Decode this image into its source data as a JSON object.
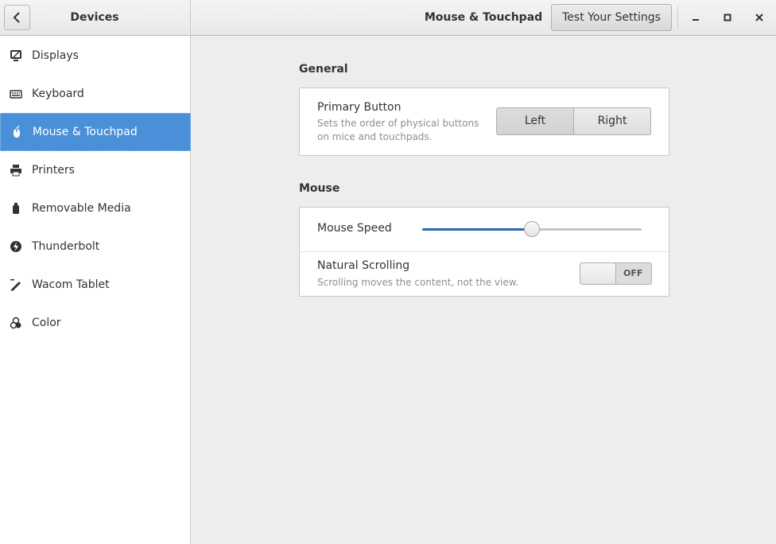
{
  "header": {
    "panel_title": "Devices",
    "page_title": "Mouse & Touchpad",
    "test_button_label": "Test Your Settings"
  },
  "sidebar": {
    "items": [
      {
        "label": "Displays",
        "icon": "display-icon"
      },
      {
        "label": "Keyboard",
        "icon": "keyboard-icon"
      },
      {
        "label": "Mouse & Touchpad",
        "icon": "mouse-icon",
        "selected": true
      },
      {
        "label": "Printers",
        "icon": "printer-icon"
      },
      {
        "label": "Removable Media",
        "icon": "usb-drive-icon"
      },
      {
        "label": "Thunderbolt",
        "icon": "thunderbolt-icon"
      },
      {
        "label": "Wacom Tablet",
        "icon": "tablet-icon"
      },
      {
        "label": "Color",
        "icon": "color-icon"
      }
    ]
  },
  "general": {
    "section_title": "General",
    "primary_button": {
      "title": "Primary Button",
      "description_line1": "Sets the order of physical buttons",
      "description_line2": "on mice and touchpads.",
      "options": [
        "Left",
        "Right"
      ],
      "selected": "Left"
    }
  },
  "mouse": {
    "section_title": "Mouse",
    "speed": {
      "title": "Mouse Speed",
      "value_fraction": 0.5
    },
    "natural_scrolling": {
      "title": "Natural Scrolling",
      "description": "Scrolling moves the content, not the view.",
      "state_label": "OFF"
    }
  },
  "colors": {
    "selection": "#4a90d9",
    "slider_fill": "#2b6bb3"
  }
}
